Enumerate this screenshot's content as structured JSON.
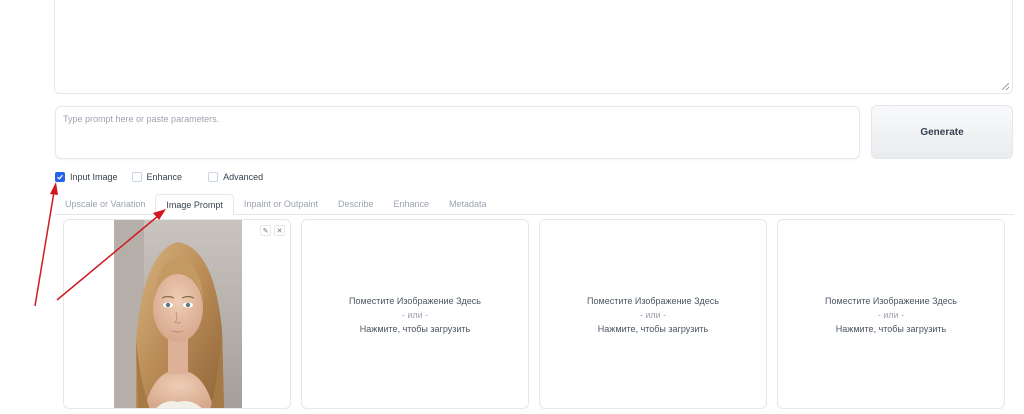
{
  "prompt": {
    "placeholder": "Type prompt here or paste parameters."
  },
  "generate_label": "Generate",
  "checkboxes": [
    {
      "label": "Input Image",
      "checked": true
    },
    {
      "label": "Enhance",
      "checked": false
    },
    {
      "label": "Advanced",
      "checked": false
    }
  ],
  "tabs": [
    {
      "label": "Upscale or Variation",
      "active": false
    },
    {
      "label": "Image Prompt",
      "active": true
    },
    {
      "label": "Inpaint or Outpaint",
      "active": false
    },
    {
      "label": "Describe",
      "active": false
    },
    {
      "label": "Enhance",
      "active": false
    },
    {
      "label": "Metadata",
      "active": false
    }
  ],
  "dropzone": {
    "line1": "Поместите Изображение Здесь",
    "or": "- или -",
    "line2": "Нажмите, чтобы загрузить"
  },
  "image_tools": {
    "edit": "✎",
    "clear": "✕"
  },
  "colors": {
    "accent": "#2563eb",
    "annotation_arrow": "#d0191f"
  }
}
